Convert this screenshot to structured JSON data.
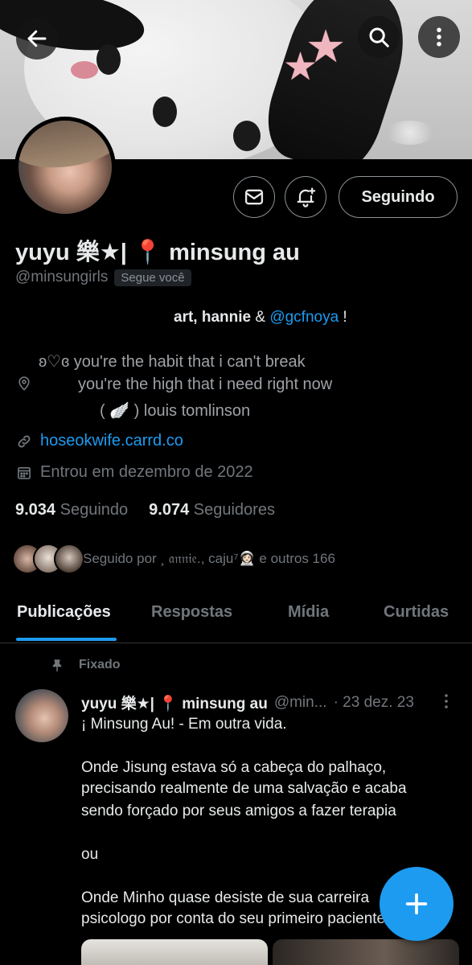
{
  "header": {
    "icons": [
      "arrow-left-icon",
      "search-icon",
      "more-vertical-icon"
    ]
  },
  "profile": {
    "display_name": "yuyu 樂★| 📍 minsung au",
    "handle": "@minsungirls",
    "follows_you_badge": "Segue você",
    "follow_button_label": "Seguindo",
    "bio_bold": "art, hannie",
    "bio_amp": " & ",
    "bio_mention": "@gcfnoya",
    "bio_end": " !",
    "location_lines": [
      "ʚ♡ɞ  you're the habit that i can't break",
      "you're the high that i need right now",
      "( 🪽 )  louis tomlinson"
    ],
    "website": "hoseokwife.carrd.co",
    "joined": "Entrou em dezembro de 2022",
    "following_count": "9.034",
    "following_label": "Seguindo",
    "followers_count": "9.074",
    "followers_label": "Seguidores",
    "followed_by_text": "Seguido por ¸ 𝔞𝔫𝔫𝔦𝔢., caju⁷👩🏻‍🚀 e outros 166"
  },
  "tabs": [
    {
      "label": "Publicações",
      "active": true
    },
    {
      "label": "Respostas",
      "active": false
    },
    {
      "label": "Mídia",
      "active": false
    },
    {
      "label": "Curtidas",
      "active": false
    }
  ],
  "post": {
    "pinned_label": "Fixado",
    "author_name": "yuyu 樂★| 📍 minsung au",
    "author_handle": "@min...",
    "date": "· 23 dez. 23",
    "lines": [
      "¡ Minsung Au! - Em outra vida.",
      "Onde Jisung estava só a cabeça do palhaço,",
      "precisando realmente de uma salvação e acaba",
      "sendo forçado por seus amigos a fazer terapia",
      "ou",
      "Onde Minho quase desiste de sua carreira",
      "psicologo por conta do seu primeiro paciente"
    ]
  },
  "colors": {
    "accent": "#1d9bf0",
    "background": "#000000",
    "text_primary": "#e7e9ea",
    "text_secondary": "#71767b"
  }
}
